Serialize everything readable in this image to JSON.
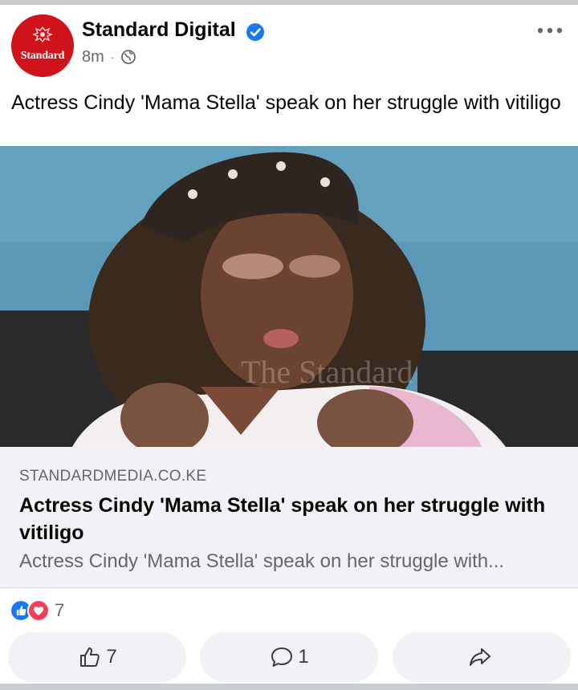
{
  "post": {
    "page_name": "Standard Digital",
    "avatar_text": "Standard",
    "time": "8m",
    "separator": "·",
    "audience_icon": "globe-icon",
    "verified_icon": "verified-badge-icon",
    "more_icon": "more-options-icon",
    "caption": "Actress Cindy 'Mama Stella' speak on her struggle with vitiligo",
    "image_watermark": "The Standard"
  },
  "link_preview": {
    "domain": "STANDARDMEDIA.CO.KE",
    "title": "Actress Cindy 'Mama Stella' speak on her struggle with vitiligo",
    "description": "Actress Cindy 'Mama Stella' speak on her struggle with..."
  },
  "reactions": {
    "icons": [
      "like-reaction-icon",
      "love-reaction-icon"
    ],
    "count": "7"
  },
  "actions": {
    "like_count": "7",
    "comment_count": "1",
    "share_icon": "share-icon"
  },
  "colors": {
    "brand_red": "#d0121b",
    "facebook_blue": "#1877f2",
    "love_red": "#f33e58",
    "muted_text": "#65676b",
    "preview_bg": "#f0f2f5"
  }
}
